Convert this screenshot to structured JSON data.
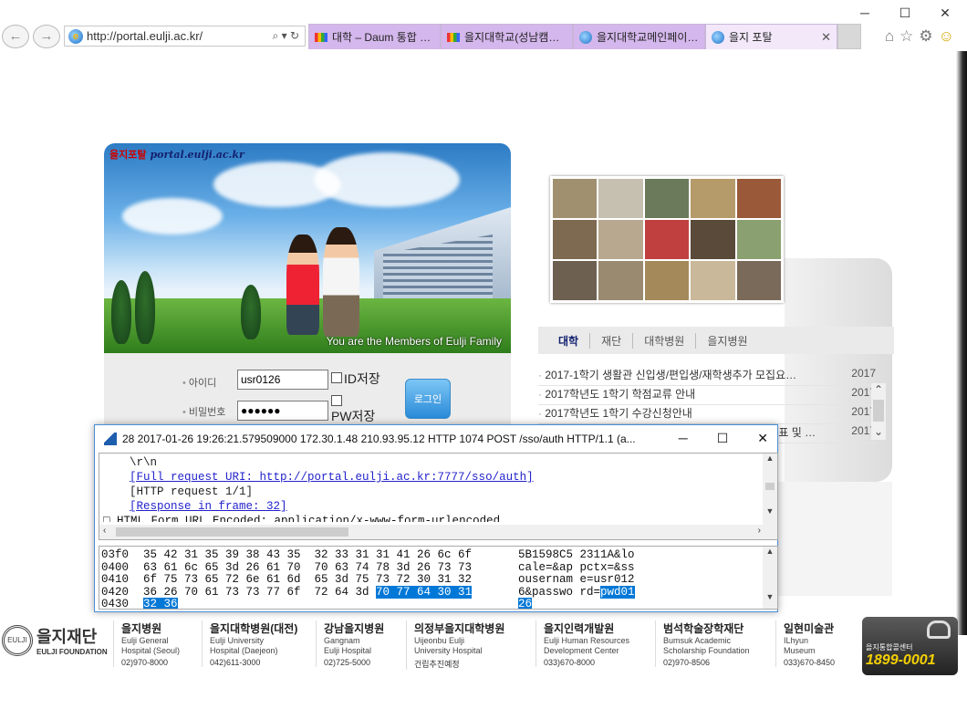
{
  "browser": {
    "window_controls": [
      "─",
      "☐",
      "✕"
    ],
    "nav": {
      "back": "←",
      "forward": "→"
    },
    "address": {
      "url": "http://portal.eulji.ac.kr/",
      "actions": "⌕ ▾ ↻"
    },
    "tabs": [
      {
        "label": "대학 – Daum 통합 …",
        "favicon": "multicolor-icon"
      },
      {
        "label": "을지대학교(성남캠…",
        "favicon": "multicolor-icon"
      },
      {
        "label": "을지대학교메인페이…",
        "favicon": "ie-icon"
      },
      {
        "label": "을지 포탈",
        "favicon": "ie-icon",
        "active": true,
        "close": "✕"
      }
    ],
    "toolbar_icons": [
      "⌂",
      "☆",
      "⚙",
      "☺"
    ]
  },
  "portal": {
    "brand": "을지포탈",
    "brand_domain": "portal.eulji.ac.kr",
    "hero_caption": "You are the Members of Eulji Family",
    "login": {
      "id_label": "아이디",
      "id_value": "usr0126",
      "pw_label": "비밀번호",
      "pw_value": "●●●●●●",
      "save_id": "ID저장",
      "save_pw": "PW저장",
      "button": "로그인"
    },
    "news_tabs": [
      "대학",
      "재단",
      "대학병원",
      "을지병원"
    ],
    "news": [
      {
        "title": "2017-1학기 생활관 신입생/편입생/재학생추가 모집요…",
        "date": "2017"
      },
      {
        "title": "2017학년도 1학기 학점교류 안내",
        "date": "2017"
      },
      {
        "title": "2017학년도 1학기 수강신청안내",
        "date": "2017"
      },
      {
        "title": "표 및 …",
        "date": "2017"
      }
    ]
  },
  "footer": {
    "logo_name": "을지재단",
    "logo_eng": "EULJI FOUNDATION",
    "items": [
      {
        "title": "을지병원",
        "sub": [
          "Eulji General",
          "Hospital (Seoul)"
        ],
        "phone": "02)970-8000"
      },
      {
        "title": "을지대학병원(대전)",
        "sub": [
          "Eulji University",
          "Hospital (Daejeon)"
        ],
        "phone": "042)611-3000"
      },
      {
        "title": "강남을지병원",
        "sub": [
          "Gangnam",
          "Eulji Hospital"
        ],
        "phone": "02)725-5000"
      },
      {
        "title": "의정부을지대학병원",
        "sub": [
          "Uijeonbu Eulji",
          "University Hospital"
        ],
        "phone": "건립추진예정"
      },
      {
        "title": "을지인력개발원",
        "sub": [
          "Eulji Human Resources",
          "Development Center"
        ],
        "phone": "033)670-8000"
      },
      {
        "title": "범석학술장학재단",
        "sub": [
          "Bumsuk Academic",
          "Scholarship Foundation"
        ],
        "phone": "02)970-8506"
      },
      {
        "title": "일현미술관",
        "sub": [
          "ILhyun",
          "Museum"
        ],
        "phone": "033)670-8450"
      }
    ],
    "callcenter": {
      "title": "을지통합콜센터",
      "number": "1899-0001"
    }
  },
  "wireshark": {
    "title": "28 2017-01-26 19:26:21.579509000 172.30.1.48 210.93.95.12 HTTP 1074 POST /sso/auth HTTP/1.1  (a...",
    "controls": [
      "─",
      "☐",
      "✕"
    ],
    "detail_lines": [
      {
        "text": "\\r\\n",
        "link": false
      },
      {
        "text": "[Full request URI: http://portal.eulji.ac.kr:7777/sso/auth]",
        "link": true
      },
      {
        "text": "[HTTP request 1/1]",
        "link": false
      },
      {
        "text": "[Response in frame: 32]",
        "link": true
      }
    ],
    "cut_line": "□ HTML Form URL Encoded: application/x-www-form-urlencoded",
    "hex_rows": [
      {
        "off": "03f0",
        "hex_a": "35 42 31 35 39 38 43 35  32 33 31 31 41 26 6c 6f",
        "hex_sel": "",
        "asc_a": "5B1598C5 2311A&lo",
        "asc_sel": ""
      },
      {
        "off": "0400",
        "hex_a": "63 61 6c 65 3d 26 61 70  70 63 74 78 3d 26 73 73",
        "hex_sel": "",
        "asc_a": "cale=&ap pctx=&ss",
        "asc_sel": ""
      },
      {
        "off": "0410",
        "hex_a": "6f 75 73 65 72 6e 61 6d  65 3d 75 73 72 30 31 32",
        "hex_sel": "",
        "asc_a": "ousernam e=usr012",
        "asc_sel": ""
      },
      {
        "off": "0420",
        "hex_a": "36 26 70 61 73 73 77 6f  72 64 3d ",
        "hex_sel": "70 77 64 30 31",
        "asc_a": "6&passwo rd=",
        "asc_sel": "pwd01"
      },
      {
        "off": "0430",
        "hex_a": "",
        "hex_sel": "32 36",
        "asc_a": "",
        "asc_sel": "26"
      }
    ]
  }
}
